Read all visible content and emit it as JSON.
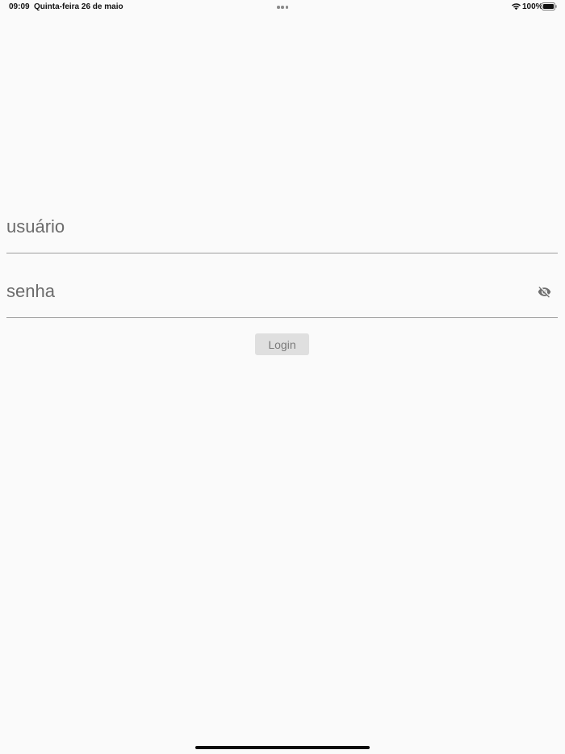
{
  "status_bar": {
    "time": "09:09",
    "date": "Quinta-feira 26 de maio",
    "battery_percent": "100%",
    "battery_level": 1.0,
    "wifi_icon": "wifi-icon",
    "battery_icon": "battery-icon"
  },
  "login_form": {
    "username": {
      "placeholder": "usuário",
      "value": ""
    },
    "password": {
      "placeholder": "senha",
      "value": "",
      "visibility_icon": "eye-off-icon"
    },
    "login_label": "Login"
  },
  "colors": {
    "background": "#fafafa",
    "field_underline": "#9e9e9e",
    "placeholder": "#6b6b6b",
    "button_bg": "#dfdfdf",
    "button_text": "#7a7a7a"
  }
}
